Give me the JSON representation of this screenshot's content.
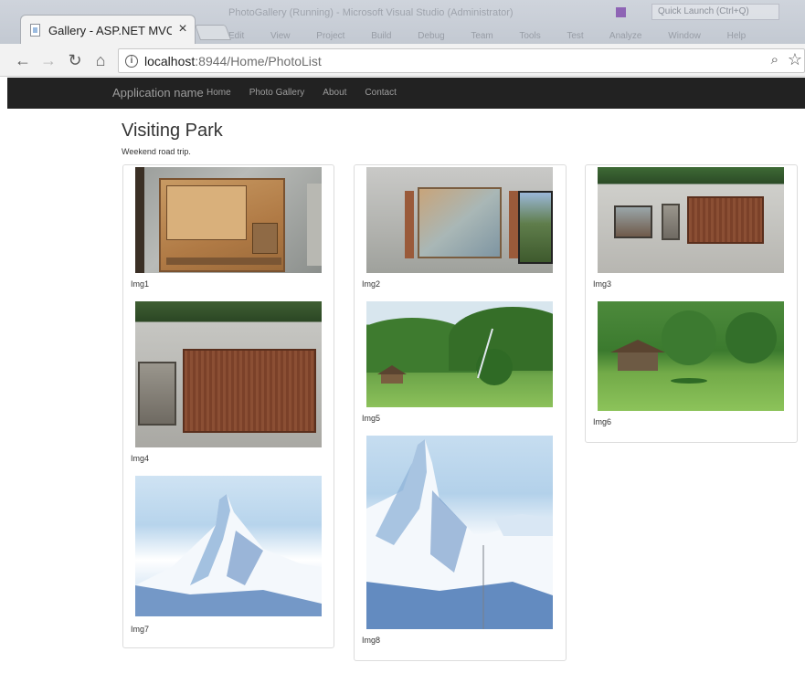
{
  "window": {
    "background_title": "PhotoGallery (Running) - Microsoft Visual Studio (Administrator)",
    "background_menu": [
      "Edit",
      "View",
      "Project",
      "Build",
      "Debug",
      "Team",
      "Tools",
      "Test",
      "Analyze",
      "Window",
      "Help"
    ],
    "background_search": "Quick Launch (Ctrl+Q)"
  },
  "browser": {
    "tab_title": "Gallery - ASP.NET MVC T",
    "tab_close": "×",
    "url_host": "localhost",
    "url_rest": ":8944/Home/PhotoList"
  },
  "navbar": {
    "brand": "Application name",
    "links": [
      "Home",
      "Photo Gallery",
      "About",
      "Contact"
    ]
  },
  "page": {
    "title": "Visiting Park",
    "subtitle": "Weekend road trip."
  },
  "photos": [
    {
      "caption": "Img1",
      "subject": "plaque-map"
    },
    {
      "caption": "Img2",
      "subject": "relief-wall"
    },
    {
      "caption": "Img3",
      "subject": "long-wall"
    },
    {
      "caption": "Img4",
      "subject": "inscription-wall"
    },
    {
      "caption": "Img5",
      "subject": "park-pavilion"
    },
    {
      "caption": "Img6",
      "subject": "park-pavilion-close"
    },
    {
      "caption": "Img7",
      "subject": "snowy-mountain"
    },
    {
      "caption": "Img8",
      "subject": "snowy-mountain-tall"
    }
  ],
  "icons": {
    "back": "arrow-left-icon",
    "forward": "arrow-right-icon",
    "reload": "reload-icon",
    "home": "home-icon",
    "info": "info-icon",
    "zoom": "zoom-icon",
    "bookmark": "star-icon"
  },
  "colors": {
    "navbar_bg": "#222222",
    "navbar_text": "#9d9d9d",
    "panel_border": "#dcdcdc"
  }
}
